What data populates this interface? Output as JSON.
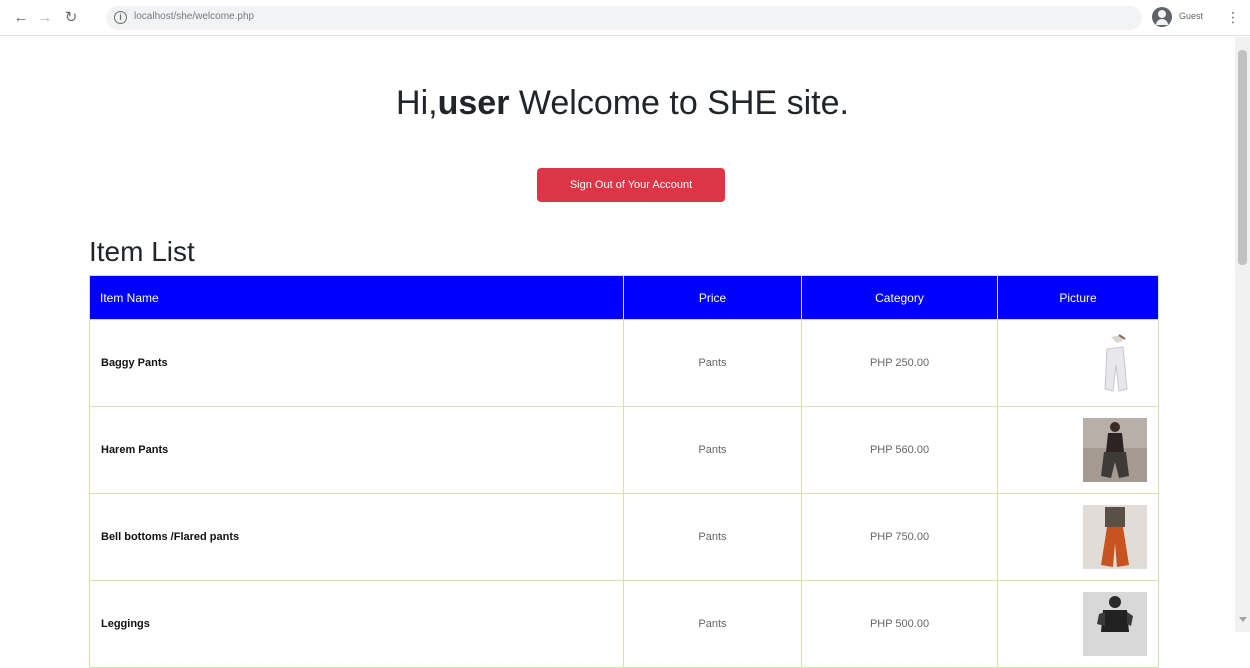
{
  "browser": {
    "url": "localhost/she/welcome.php",
    "profile_label": "Guest"
  },
  "page": {
    "greeting_prefix": "Hi,",
    "username": "user",
    "greeting_suffix": " Welcome to SHE site.",
    "signout_label": "Sign Out of Your Account",
    "list_heading": "Item List"
  },
  "table": {
    "headers": [
      "Item Name",
      "Price",
      "Category",
      "Picture"
    ],
    "rows": [
      {
        "name": "Baggy Pants",
        "price": "Pants",
        "category": "PHP 250.00",
        "picture": "baggy-pants-photo"
      },
      {
        "name": "Harem Pants",
        "price": "Pants",
        "category": "PHP 560.00",
        "picture": "harem-pants-photo"
      },
      {
        "name": "Bell bottoms /Flared pants",
        "price": "Pants",
        "category": "PHP 750.00",
        "picture": "flared-pants-photo"
      },
      {
        "name": "Leggings",
        "price": "Pants",
        "category": "PHP 500.00",
        "picture": "leggings-photo"
      }
    ]
  },
  "colors": {
    "header_bg": "#0000ff",
    "signout_bg": "#dc3545",
    "table_border": "#d6e3a8"
  }
}
